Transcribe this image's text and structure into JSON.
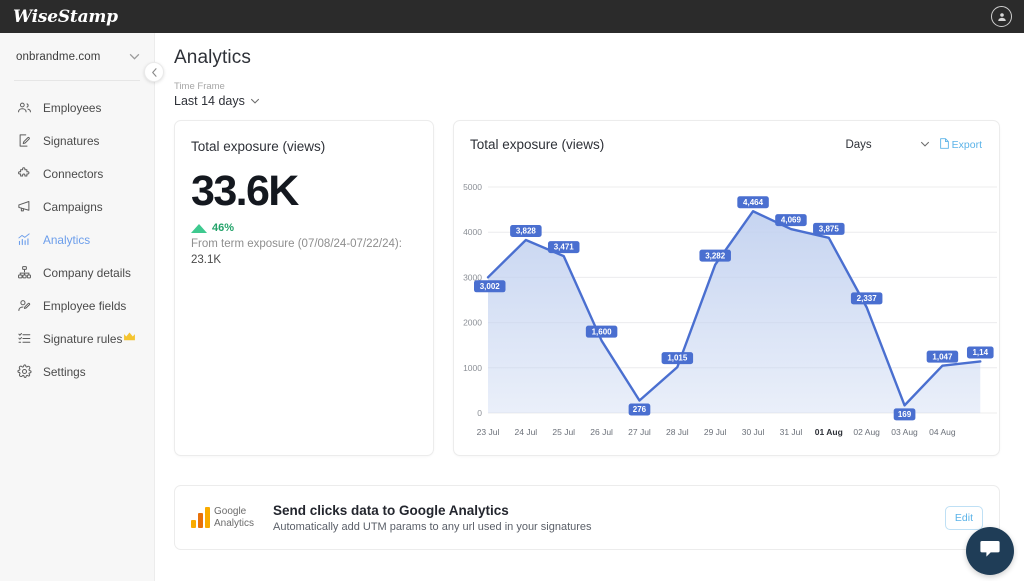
{
  "topbar": {
    "brand": "WiseStamp",
    "avatar_icon": "user-circle-icon"
  },
  "sidebar": {
    "domain": "onbrandme.com",
    "domain_chevron": "chevron-down-icon",
    "collapse_icon": "chevron-left-icon",
    "items": [
      {
        "label": "Employees",
        "icon": "people-icon",
        "active": false,
        "badge": ""
      },
      {
        "label": "Signatures",
        "icon": "signature-icon",
        "active": false,
        "badge": ""
      },
      {
        "label": "Connectors",
        "icon": "puzzle-icon",
        "active": false,
        "badge": ""
      },
      {
        "label": "Campaigns",
        "icon": "megaphone-icon",
        "active": false,
        "badge": ""
      },
      {
        "label": "Analytics",
        "icon": "analytics-icon",
        "active": true,
        "badge": ""
      },
      {
        "label": "Company details",
        "icon": "org-chart-icon",
        "active": false,
        "badge": ""
      },
      {
        "label": "Employee fields",
        "icon": "user-edit-icon",
        "active": false,
        "badge": ""
      },
      {
        "label": "Signature rules",
        "icon": "list-rules-icon",
        "active": false,
        "badge": "crown-icon"
      },
      {
        "label": "Settings",
        "icon": "gear-icon",
        "active": false,
        "badge": ""
      }
    ]
  },
  "main": {
    "page_title": "Analytics",
    "time_frame_label": "Time Frame",
    "time_frame_value": "Last 14 days",
    "time_frame_chevron": "chevron-down-icon"
  },
  "kpi_card": {
    "title": "Total exposure (views)",
    "value": "33.6K",
    "delta_icon": "triangle-up-icon",
    "delta": "46%",
    "compare_text": "From term exposure (07/08/24-07/22/24):",
    "compare_value": "23.1K"
  },
  "chart_card": {
    "title": "Total exposure (views)",
    "granularity": "Days",
    "granularity_chevron": "chevron-down-icon",
    "export_label": "Export",
    "export_icon": "file-export-icon"
  },
  "chart_data": {
    "type": "area",
    "title": "Total exposure (views)",
    "xlabel": "",
    "ylabel": "",
    "grid": true,
    "legend": false,
    "ylim": [
      0,
      5000
    ],
    "yticks": [
      0,
      1000,
      2000,
      3000,
      4000,
      5000
    ],
    "ytick_labels": [
      "0",
      "1000",
      "2000",
      "3000",
      "4000",
      "5000"
    ],
    "categories": [
      "23 Jul",
      "24 Jul",
      "25 Jul",
      "26 Jul",
      "27 Jul",
      "28 Jul",
      "29 Jul",
      "30 Jul",
      "31 Jul",
      "01 Aug",
      "02 Aug",
      "03 Aug",
      "04 Aug",
      ""
    ],
    "bold_categories": [
      "01 Aug"
    ],
    "values": [
      3002,
      3828,
      3471,
      1600,
      276,
      1015,
      3282,
      4464,
      4069,
      3875,
      2337,
      169,
      1047,
      1140
    ],
    "point_labels": [
      "3,002",
      "3,828",
      "3,471",
      "1,600",
      "276",
      "1,015",
      "3,282",
      "4,464",
      "4,069",
      "3,875",
      "2,337",
      "169",
      "1,047",
      "1,14"
    ],
    "line_color": "#4a6fd0",
    "fill_color": "#c3d2f0",
    "label_bg": "#4a6fd0",
    "label_text_color": "#ffffff"
  },
  "ga_card": {
    "logo_text_line1": "Google",
    "logo_text_line2": "Analytics",
    "title": "Send clicks data to Google Analytics",
    "subtitle": "Automatically add UTM params to any url used in your signatures",
    "edit_label": "Edit"
  },
  "chat": {
    "icon": "chat-bubble-icon"
  },
  "colors": {
    "accent_blue": "#6c9eeb",
    "link_blue": "#5bb3e8",
    "green": "#23a36a",
    "topbar_bg": "#2b2b2b",
    "sidebar_bg": "#f7f7f7",
    "chat_bg": "#1f3d57"
  }
}
